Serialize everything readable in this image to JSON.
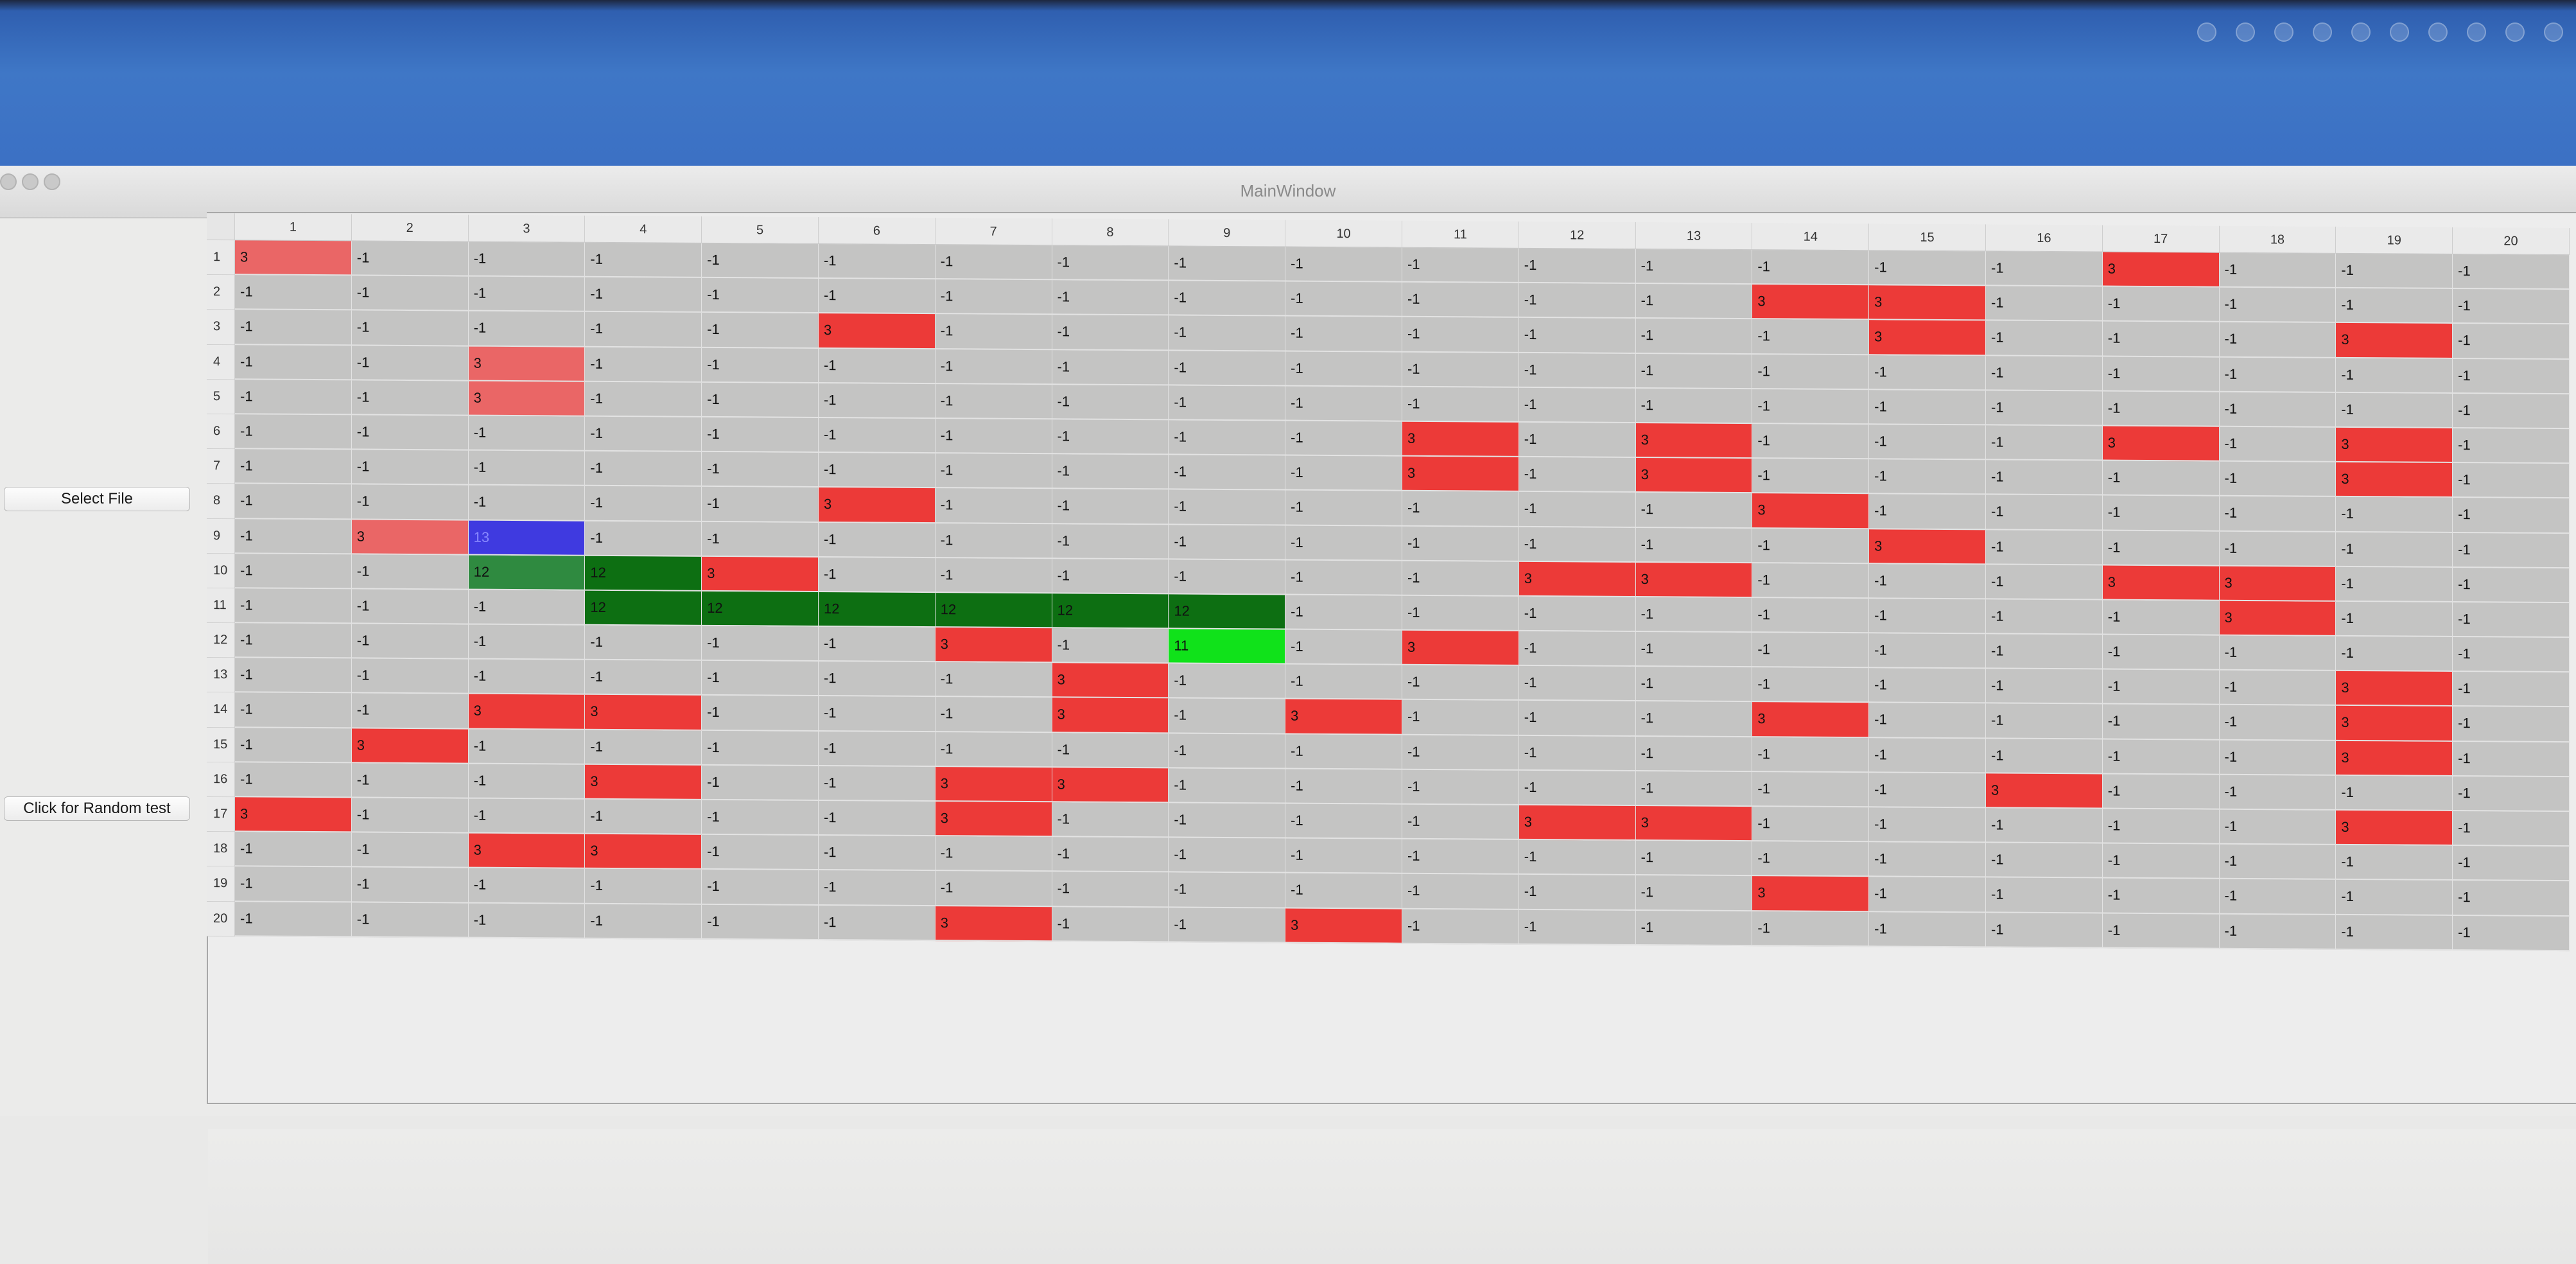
{
  "window": {
    "title": "MainWindow"
  },
  "buttons": {
    "select_file": "Select File",
    "random_test": "Click for Random test"
  },
  "colors": {
    "cell_default": "#c4c4c3",
    "value_3": "#ec3a38",
    "value_3_selected": "#ea6666",
    "value_12": "#0d6f12",
    "value_12_selected": "#2f8a40",
    "value_11": "#10e21a",
    "value_13": "#3f3ae0"
  },
  "table": {
    "columns": [
      "1",
      "2",
      "3",
      "4",
      "5",
      "6",
      "7",
      "8",
      "9",
      "10",
      "11",
      "12",
      "13",
      "14",
      "15",
      "16",
      "17",
      "18",
      "19",
      "20"
    ],
    "rows": [
      {
        "label": "1",
        "cells": [
          "3",
          "-1",
          "-1",
          "-1",
          "-1",
          "-1",
          "-1",
          "-1",
          "-1",
          "-1",
          "-1",
          "-1",
          "-1",
          "-1",
          "-1",
          "-1",
          "3",
          "-1",
          "-1",
          "-1"
        ]
      },
      {
        "label": "2",
        "cells": [
          "-1",
          "-1",
          "-1",
          "-1",
          "-1",
          "-1",
          "-1",
          "-1",
          "-1",
          "-1",
          "-1",
          "-1",
          "-1",
          "3",
          "3",
          "-1",
          "-1",
          "-1",
          "-1",
          "-1"
        ]
      },
      {
        "label": "3",
        "cells": [
          "-1",
          "-1",
          "-1",
          "-1",
          "-1",
          "3",
          "-1",
          "-1",
          "-1",
          "-1",
          "-1",
          "-1",
          "-1",
          "-1",
          "3",
          "-1",
          "-1",
          "-1",
          "3",
          "-1"
        ]
      },
      {
        "label": "4",
        "cells": [
          "-1",
          "-1",
          "3",
          "-1",
          "-1",
          "-1",
          "-1",
          "-1",
          "-1",
          "-1",
          "-1",
          "-1",
          "-1",
          "-1",
          "-1",
          "-1",
          "-1",
          "-1",
          "-1",
          "-1"
        ]
      },
      {
        "label": "5",
        "cells": [
          "-1",
          "-1",
          "3",
          "-1",
          "-1",
          "-1",
          "-1",
          "-1",
          "-1",
          "-1",
          "-1",
          "-1",
          "-1",
          "-1",
          "-1",
          "-1",
          "-1",
          "-1",
          "-1",
          "-1"
        ]
      },
      {
        "label": "6",
        "cells": [
          "-1",
          "-1",
          "-1",
          "-1",
          "-1",
          "-1",
          "-1",
          "-1",
          "-1",
          "-1",
          "3",
          "-1",
          "3",
          "-1",
          "-1",
          "-1",
          "3",
          "-1",
          "3",
          "-1"
        ]
      },
      {
        "label": "7",
        "cells": [
          "-1",
          "-1",
          "-1",
          "-1",
          "-1",
          "-1",
          "-1",
          "-1",
          "-1",
          "-1",
          "3",
          "-1",
          "3",
          "-1",
          "-1",
          "-1",
          "-1",
          "-1",
          "3",
          "-1"
        ]
      },
      {
        "label": "8",
        "cells": [
          "-1",
          "-1",
          "-1",
          "-1",
          "-1",
          "3",
          "-1",
          "-1",
          "-1",
          "-1",
          "-1",
          "-1",
          "-1",
          "3",
          "-1",
          "-1",
          "-1",
          "-1",
          "-1",
          "-1"
        ]
      },
      {
        "label": "9",
        "cells": [
          "-1",
          "3",
          "13",
          "-1",
          "-1",
          "-1",
          "-1",
          "-1",
          "-1",
          "-1",
          "-1",
          "-1",
          "-1",
          "-1",
          "3",
          "-1",
          "-1",
          "-1",
          "-1",
          "-1"
        ]
      },
      {
        "label": "10",
        "cells": [
          "-1",
          "-1",
          "12",
          "12",
          "3",
          "-1",
          "-1",
          "-1",
          "-1",
          "-1",
          "-1",
          "3",
          "3",
          "-1",
          "-1",
          "-1",
          "3",
          "3",
          "-1",
          "-1"
        ]
      },
      {
        "label": "11",
        "cells": [
          "-1",
          "-1",
          "-1",
          "12",
          "12",
          "12",
          "12",
          "12",
          "12",
          "-1",
          "-1",
          "-1",
          "-1",
          "-1",
          "-1",
          "-1",
          "-1",
          "3",
          "-1",
          "-1"
        ]
      },
      {
        "label": "12",
        "cells": [
          "-1",
          "-1",
          "-1",
          "-1",
          "-1",
          "-1",
          "3",
          "-1",
          "11",
          "-1",
          "3",
          "-1",
          "-1",
          "-1",
          "-1",
          "-1",
          "-1",
          "-1",
          "-1",
          "-1"
        ]
      },
      {
        "label": "13",
        "cells": [
          "-1",
          "-1",
          "-1",
          "-1",
          "-1",
          "-1",
          "-1",
          "3",
          "-1",
          "-1",
          "-1",
          "-1",
          "-1",
          "-1",
          "-1",
          "-1",
          "-1",
          "-1",
          "3",
          "-1"
        ]
      },
      {
        "label": "14",
        "cells": [
          "-1",
          "-1",
          "3",
          "3",
          "-1",
          "-1",
          "-1",
          "3",
          "-1",
          "3",
          "-1",
          "-1",
          "-1",
          "3",
          "-1",
          "-1",
          "-1",
          "-1",
          "3",
          "-1"
        ]
      },
      {
        "label": "15",
        "cells": [
          "-1",
          "3",
          "-1",
          "-1",
          "-1",
          "-1",
          "-1",
          "-1",
          "-1",
          "-1",
          "-1",
          "-1",
          "-1",
          "-1",
          "-1",
          "-1",
          "-1",
          "-1",
          "3",
          "-1"
        ]
      },
      {
        "label": "16",
        "cells": [
          "-1",
          "-1",
          "-1",
          "3",
          "-1",
          "-1",
          "3",
          "3",
          "-1",
          "-1",
          "-1",
          "-1",
          "-1",
          "-1",
          "-1",
          "3",
          "-1",
          "-1",
          "-1",
          "-1"
        ]
      },
      {
        "label": "17",
        "cells": [
          "3",
          "-1",
          "-1",
          "-1",
          "-1",
          "-1",
          "3",
          "-1",
          "-1",
          "-1",
          "-1",
          "3",
          "3",
          "-1",
          "-1",
          "-1",
          "-1",
          "-1",
          "3",
          "-1"
        ]
      },
      {
        "label": "18",
        "cells": [
          "-1",
          "-1",
          "3",
          "3",
          "-1",
          "-1",
          "-1",
          "-1",
          "-1",
          "-1",
          "-1",
          "-1",
          "-1",
          "-1",
          "-1",
          "-1",
          "-1",
          "-1",
          "-1",
          "-1"
        ]
      },
      {
        "label": "19",
        "cells": [
          "-1",
          "-1",
          "-1",
          "-1",
          "-1",
          "-1",
          "-1",
          "-1",
          "-1",
          "-1",
          "-1",
          "-1",
          "-1",
          "3",
          "-1",
          "-1",
          "-1",
          "-1",
          "-1",
          "-1"
        ]
      },
      {
        "label": "20",
        "cells": [
          "-1",
          "-1",
          "-1",
          "-1",
          "-1",
          "-1",
          "3",
          "-1",
          "-1",
          "3",
          "-1",
          "-1",
          "-1",
          "-1",
          "-1",
          "-1",
          "-1",
          "-1",
          "-1",
          "-1"
        ]
      }
    ]
  }
}
